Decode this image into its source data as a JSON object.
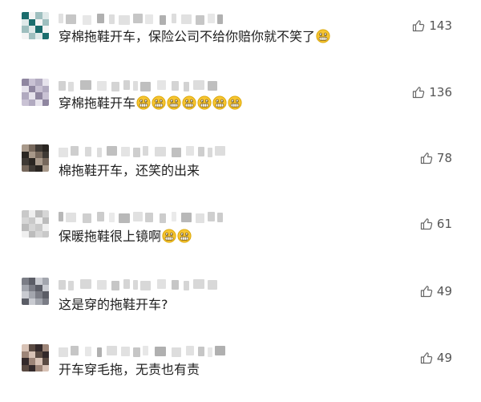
{
  "comments": [
    {
      "text": "穿棉拖鞋开车，保险公司不给你赔你就不笑了",
      "emoji_count": 1,
      "likes": "143"
    },
    {
      "text": "穿棉拖鞋开车",
      "emoji_count": 7,
      "likes": "136"
    },
    {
      "text": "棉拖鞋开车，还笑的出来",
      "emoji_count": 0,
      "likes": "78"
    },
    {
      "text": "保暖拖鞋很上镜啊",
      "emoji_count": 2,
      "likes": "61"
    },
    {
      "text": "这是穿的拖鞋开车?",
      "emoji_count": 0,
      "likes": "49"
    },
    {
      "text": "开车穿毛拖，无责也有责",
      "emoji_count": 0,
      "likes": "49"
    }
  ],
  "icons": {
    "like": "thumbs-up-icon",
    "emoji": "grinning-face-emoji"
  }
}
